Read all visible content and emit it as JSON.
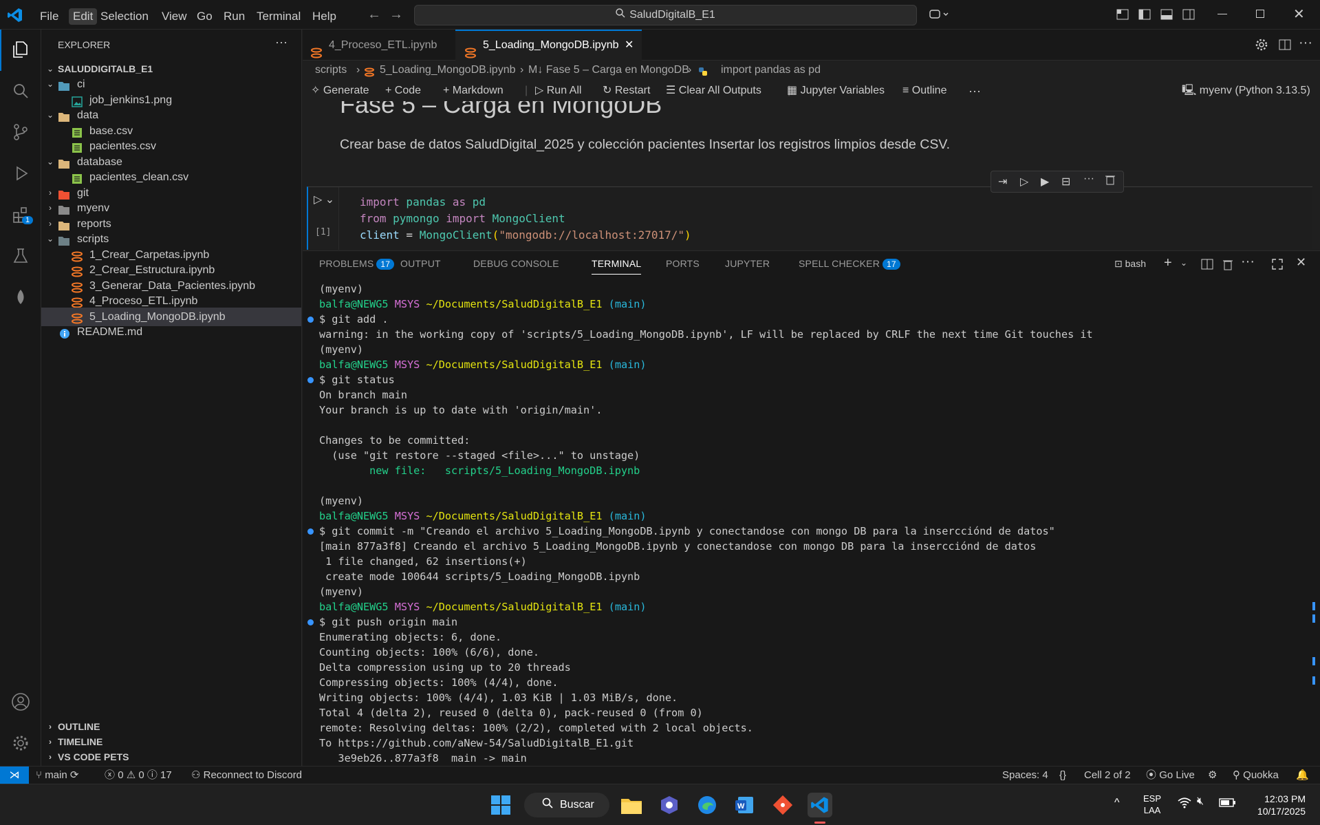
{
  "menu": {
    "items": [
      "File",
      "Edit",
      "Selection",
      "View",
      "Go",
      "Run",
      "Terminal",
      "Help"
    ],
    "active": "Edit"
  },
  "search": {
    "text": "SaludDigitalB_E1"
  },
  "sidebar": {
    "header": "EXPLORER",
    "root": "SALUDDIGITALB_E1",
    "tree": [
      {
        "label": "ci",
        "type": "folder",
        "open": true,
        "depth": 1
      },
      {
        "label": "job_jenkins1.png",
        "type": "image",
        "depth": 2
      },
      {
        "label": "data",
        "type": "folder",
        "open": true,
        "depth": 1
      },
      {
        "label": "base.csv",
        "type": "csv",
        "depth": 2
      },
      {
        "label": "pacientes.csv",
        "type": "csv",
        "depth": 2
      },
      {
        "label": "database",
        "type": "folder",
        "open": true,
        "depth": 1
      },
      {
        "label": "pacientes_clean.csv",
        "type": "csv",
        "depth": 2
      },
      {
        "label": "git",
        "type": "folder",
        "open": false,
        "depth": 1
      },
      {
        "label": "myenv",
        "type": "folder",
        "open": false,
        "depth": 1
      },
      {
        "label": "reports",
        "type": "folder",
        "open": false,
        "depth": 1
      },
      {
        "label": "scripts",
        "type": "folder",
        "open": true,
        "depth": 1
      },
      {
        "label": "1_Crear_Carpetas.ipynb",
        "type": "notebook",
        "depth": 2
      },
      {
        "label": "2_Crear_Estructura.ipynb",
        "type": "notebook",
        "depth": 2
      },
      {
        "label": "3_Generar_Data_Pacientes.ipynb",
        "type": "notebook",
        "depth": 2
      },
      {
        "label": "4_Proceso_ETL.ipynb",
        "type": "notebook",
        "depth": 2
      },
      {
        "label": "5_Loading_MongoDB.ipynb",
        "type": "notebook",
        "depth": 2,
        "selected": true
      },
      {
        "label": "README.md",
        "type": "info",
        "depth": 1
      }
    ],
    "sections": [
      "OUTLINE",
      "TIMELINE",
      "VS CODE PETS"
    ]
  },
  "editor": {
    "tabs": [
      {
        "label": "4_Proceso_ETL.ipynb"
      },
      {
        "label": "5_Loading_MongoDB.ipynb",
        "close": "✕"
      }
    ],
    "breadcrumb": [
      "scripts",
      "5_Loading_MongoDB.ipynb",
      "M↓ Fase 5 – Carga en MongoDB",
      "import pandas as pd"
    ],
    "toolbar": {
      "generate": "Generate",
      "code": "Code",
      "markdown": "Markdown",
      "run_all": "Run All",
      "restart": "Restart",
      "clear": "Clear All Outputs",
      "variables": "Jupyter Variables",
      "outline": "Outline",
      "kernel": "myenv (Python 3.13.5)"
    },
    "heading": "Fase 5 – Carga en MongoDB",
    "description": "Crear base de datos SaludDigital_2025 y colección pacientes Insertar los registros limpios desde CSV.",
    "cell_index": "[1]",
    "code": [
      [
        {
          "t": "import",
          "c": "#c586c0"
        },
        {
          "t": " pandas ",
          "c": "#4ec9b0"
        },
        {
          "t": "as",
          "c": "#c586c0"
        },
        {
          "t": " pd",
          "c": "#4ec9b0"
        }
      ],
      [
        {
          "t": "from",
          "c": "#c586c0"
        },
        {
          "t": " pymongo ",
          "c": "#4ec9b0"
        },
        {
          "t": "import",
          "c": "#c586c0"
        },
        {
          "t": " MongoClient",
          "c": "#4ec9b0"
        }
      ],
      [
        {
          "t": "client",
          "c": "#9cdcfe"
        },
        {
          "t": " = ",
          "c": "#d4d4d4"
        },
        {
          "t": "MongoClient",
          "c": "#4ec9b0"
        },
        {
          "t": "(",
          "c": "#ffd700"
        },
        {
          "t": "\"mongodb://localhost:27017/\"",
          "c": "#ce9178"
        },
        {
          "t": ")",
          "c": "#ffd700"
        }
      ]
    ]
  },
  "panel": {
    "tabs": [
      {
        "label": "PROBLEMS",
        "badge": "17"
      },
      {
        "label": "OUTPUT"
      },
      {
        "label": "DEBUG CONSOLE"
      },
      {
        "label": "TERMINAL",
        "active": true
      },
      {
        "label": "PORTS"
      },
      {
        "label": "JUPYTER"
      },
      {
        "label": "SPELL CHECKER",
        "badge": "17"
      }
    ],
    "shell": "bash",
    "terminal": [
      {
        "text": "(myenv)"
      },
      {
        "prompt": true
      },
      {
        "cmd": "$ git add ."
      },
      {
        "text": "warning: in the working copy of 'scripts/5_Loading_MongoDB.ipynb', LF will be replaced by CRLF the next time Git touches it"
      },
      {
        "text": "(myenv)"
      },
      {
        "prompt": true
      },
      {
        "cmd": "$ git status"
      },
      {
        "text": "On branch main"
      },
      {
        "text": "Your branch is up to date with 'origin/main'."
      },
      {
        "text": ""
      },
      {
        "text": "Changes to be committed:"
      },
      {
        "text": "  (use \"git restore --staged <file>...\" to unstage)"
      },
      {
        "added": "        new file:   scripts/5_Loading_MongoDB.ipynb"
      },
      {
        "text": ""
      },
      {
        "text": "(myenv)"
      },
      {
        "prompt": true
      },
      {
        "cmd": "$ git commit -m \"Creando el archivo 5_Loading_MongoDB.ipynb y conectandose con mongo DB para la insercciónd de datos\""
      },
      {
        "text": "[main 877a3f8] Creando el archivo 5_Loading_MongoDB.ipynb y conectandose con mongo DB para la insercciónd de datos"
      },
      {
        "text": " 1 file changed, 62 insertions(+)"
      },
      {
        "text": " create mode 100644 scripts/5_Loading_MongoDB.ipynb"
      },
      {
        "text": "(myenv)"
      },
      {
        "prompt": true
      },
      {
        "cmd": "$ git push origin main"
      },
      {
        "text": "Enumerating objects: 6, done."
      },
      {
        "text": "Counting objects: 100% (6/6), done."
      },
      {
        "text": "Delta compression using up to 20 threads"
      },
      {
        "text": "Compressing objects: 100% (4/4), done."
      },
      {
        "text": "Writing objects: 100% (4/4), 1.03 KiB | 1.03 MiB/s, done."
      },
      {
        "text": "Total 4 (delta 2), reused 0 (delta 0), pack-reused 0 (from 0)"
      },
      {
        "text": "remote: Resolving deltas: 100% (2/2), completed with 2 local objects."
      },
      {
        "text": "To https://github.com/aNew-54/SaludDigitalB_E1.git"
      },
      {
        "text": "   3e9eb26..877a3f8  main -> main"
      }
    ],
    "prompt": {
      "user": "balfa@NEWG5",
      "env": "MSYS",
      "path": "~/Documents/SaludDigitalB_E1",
      "branch": "(main)"
    }
  },
  "statusbar": {
    "branch": "main",
    "problems": "0",
    "warnings": "0",
    "infos": "17",
    "discord": "Reconnect to Discord",
    "spaces": "Spaces: 4",
    "braces": "{}",
    "cell": "Cell 2 of 2",
    "golive": "Go Live",
    "quokka": "Quokka"
  },
  "taskbar": {
    "search": "Buscar",
    "lang1": "ESP",
    "lang2": "LAA",
    "time": "12:03 PM",
    "date": "10/17/2025"
  },
  "colors": {
    "accent": "#0078d4",
    "bg": "#1f1f1f",
    "sidebar": "#181818"
  }
}
